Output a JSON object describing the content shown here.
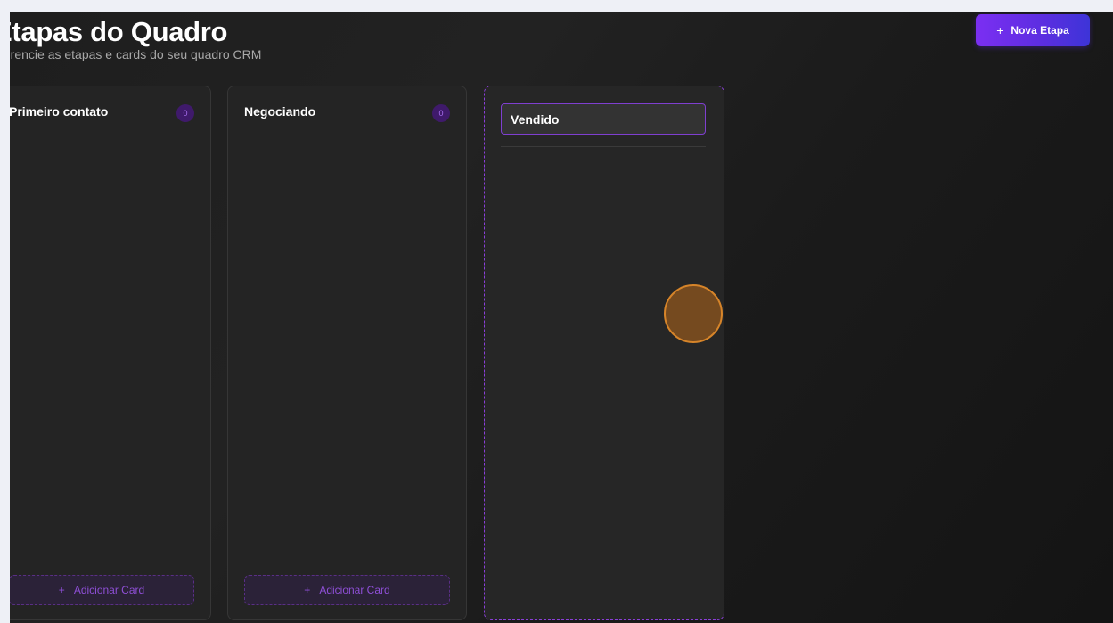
{
  "header": {
    "title": "Etapas do Quadro",
    "subtitle": "Gerencie as etapas e cards do seu quadro CRM",
    "new_stage_button": {
      "icon": "plus-icon",
      "label": "Nova Etapa"
    }
  },
  "stages": [
    {
      "title": "Primeiro contato",
      "count": "0",
      "add_card_label": "Adicionar Card"
    },
    {
      "title": "Negociando",
      "count": "0",
      "add_card_label": "Adicionar Card"
    },
    {
      "title_input_value": "Vendido",
      "editing": true
    }
  ],
  "icons": {
    "plus": "+"
  },
  "colors": {
    "accent": "#7b2ff2",
    "accent_end": "#3d34d8",
    "badge_bg": "#3f1a6b",
    "badge_text": "#a970f0",
    "drop_zone_border": "#8b3fd9",
    "cursor": "#e08a2a"
  }
}
